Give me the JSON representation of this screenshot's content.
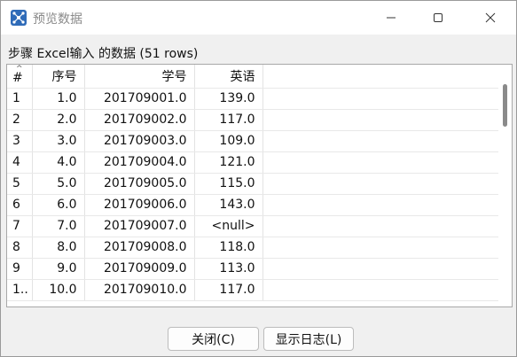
{
  "window": {
    "title": "预览数据"
  },
  "header": {
    "step_label": "步骤 Excel输入 的数据  (51 rows)"
  },
  "grid": {
    "sort_glyph": "^",
    "columns": [
      "#",
      "序号",
      "学号",
      "英语"
    ],
    "rows": [
      [
        "1",
        "1.0",
        "201709001.0",
        "139.0"
      ],
      [
        "2",
        "2.0",
        "201709002.0",
        "117.0"
      ],
      [
        "3",
        "3.0",
        "201709003.0",
        "109.0"
      ],
      [
        "4",
        "4.0",
        "201709004.0",
        "121.0"
      ],
      [
        "5",
        "5.0",
        "201709005.0",
        "115.0"
      ],
      [
        "6",
        "6.0",
        "201709006.0",
        "143.0"
      ],
      [
        "7",
        "7.0",
        "201709007.0",
        "<null>"
      ],
      [
        "8",
        "8.0",
        "201709008.0",
        "118.0"
      ],
      [
        "9",
        "9.0",
        "201709009.0",
        "113.0"
      ],
      [
        "1..",
        "10.0",
        "201709010.0",
        "117.0"
      ]
    ],
    "null_color": "#1a2bd6"
  },
  "buttons": {
    "close_label": "关闭(C)",
    "log_label": "显示日志(L)"
  },
  "icons": {
    "app": "kettle-spoon-icon",
    "minimize": "minimize-icon",
    "maximize": "maximize-icon",
    "close": "close-icon"
  }
}
